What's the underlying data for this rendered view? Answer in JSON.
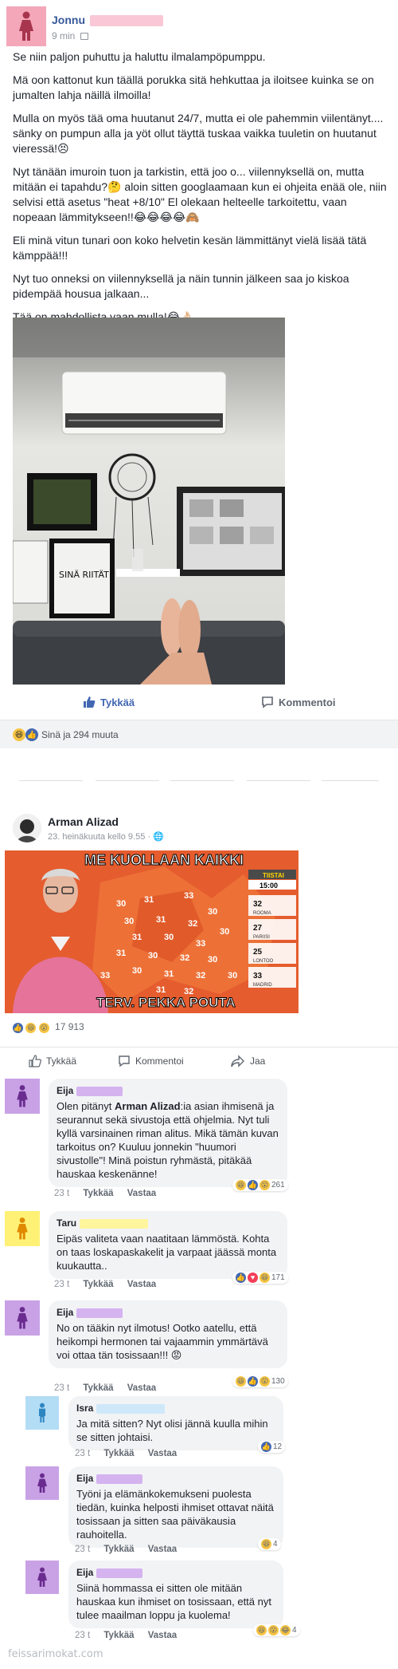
{
  "post1": {
    "author": "Jonnu",
    "time": "9 min",
    "paragraphs": [
      "Se niin paljon puhuttu ja haluttu ilmalampöpumppu.",
      "Mä oon kattonut kun täällä porukka sitä hehkuttaa ja iloitsee kuinka se on jumalten lahja näillä ilmoilla!",
      "Mulla on myös tää oma huutanut 24/7, mutta ei ole pahemmin viilentänyt.... sänky on pumpun alla ja yöt ollut täyttä tuskaa vaikka tuuletin on huutanut vieressä!😣",
      "Nyt tänään imuroin tuon ja tarkistin, että joo o... viilennyksellä on, mutta mitään ei tapahdu?🤔 aloin sitten googlaamaan kun ei ohjeita enää ole, niin selvisi että asetus \"heat +8/10\" El olekaan helteelle tarkoitettu, vaan nopeaan lämmitykseen!!😂😂😂😂🙈",
      "Eli minä vitun tunari oon koko helvetin kesän lämmittänyt vielä lisää tätä kämppää!!!",
      "Nyt tuo onneksi on viilennyksellä ja näin tunnin jälkeen saa jo kiskoa pidempää housua jalkaan...",
      "Tää on mahdollista vaan mulla!😂👌🏻"
    ],
    "photo_wall_sign": "SINÄ RIITÄT!",
    "like_label": "Tykkää",
    "comment_label": "Kommentoi",
    "reactions_text": "Sinä ja 294 muuta"
  },
  "post2": {
    "author": "Arman Alizad",
    "time": "23. heinäkuuta kello 9.55 · 🌐",
    "meme_top": "ME KUOLLAAN KAIKKI",
    "meme_bottom": "TERV. PEKKA POUTA",
    "weather_day": "TIISTAI",
    "weather_time": "15:00",
    "weather_cities": [
      {
        "temp": "32",
        "city": "ROOMA"
      },
      {
        "temp": "27",
        "city": "PARIISI"
      },
      {
        "temp": "25",
        "city": "LONTOO"
      },
      {
        "temp": "33",
        "city": "MADRID"
      }
    ],
    "map_temps": [
      "30",
      "31",
      "33",
      "30",
      "30",
      "31",
      "32",
      "30",
      "31",
      "30",
      "33",
      "31",
      "30",
      "32",
      "30",
      "30",
      "31",
      "32",
      "30",
      "31",
      "32",
      "33"
    ],
    "reaction_count": "17 913",
    "like_label": "Tykkää",
    "comment_label": "Kommentoi",
    "share_label": "Jaa"
  },
  "comments": [
    {
      "name": "Eija",
      "author_mention": "Arman Alizad",
      "text_before": "Olen pitänyt ",
      "text_after": ":ia asian ihmisenä ja seurannut sekä sivustoja että ohjelmia. Nyt tuli kyllä varsinainen riman alitus. Mikä tämän kuvan tarkoitus on? Kuuluu jonnekin \"huumori sivustolle\"! Minä poistun ryhmästä, pitäkää hauskaa keskenänne!",
      "time": "23 t",
      "like": "Tykkää",
      "reply": "Vastaa",
      "react_count": "261"
    },
    {
      "name": "Taru",
      "text": "Eipäs valiteta vaan naatitaan lämmöstä. Kohta on taas loskapaskakelit ja varpaat jäässä monta kuukautta..",
      "time": "23 t",
      "like": "Tykkää",
      "reply": "Vastaa",
      "react_count": "171"
    },
    {
      "name": "Eija",
      "text": "No on tääkin nyt ilmotus! Ootko aatellu, että heikompi hermonen tai vajaammin ymmärtävä voi ottaa tän tosissaan!!! 😡",
      "time": "23 t",
      "like": "Tykkää",
      "reply": "Vastaa",
      "react_count": "130"
    },
    {
      "name": "Isra",
      "text": "Ja mitä sitten? Nyt olisi jännä kuulla mihin se sitten johtaisi.",
      "time": "23 t",
      "like": "Tykkää",
      "reply": "Vastaa",
      "react_count": "12"
    },
    {
      "name": "Eija",
      "text": "Työni ja elämänkokemukseni puolesta tiedän, kuinka helposti ihmiset ottavat näitä tosissaan ja sitten saa päiväkausia rauhoitella.",
      "time": "23 t",
      "like": "Tykkää",
      "reply": "Vastaa",
      "react_count": "4"
    },
    {
      "name": "Eija",
      "text": "Siinä hommassa ei sitten ole mitään hauskaa kun ihmiset on tosissaan, että nyt tulee maailman loppu ja kuolema!",
      "time": "23 t",
      "like": "Tykkää",
      "reply": "Vastaa",
      "react_count": "4"
    }
  ],
  "watermark": "feissarimokat.com",
  "colors": {
    "link": "#365899",
    "like_blue": "#4267b2",
    "meta_gray": "#90949c",
    "bubble": "#f2f3f5",
    "female_avatar_pink": "#f4a7b9",
    "female_avatar_purple": "#c9a2e6",
    "taru_avatar_yellow": "#fff176",
    "isra_avatar_blue": "#b3dcf5"
  }
}
